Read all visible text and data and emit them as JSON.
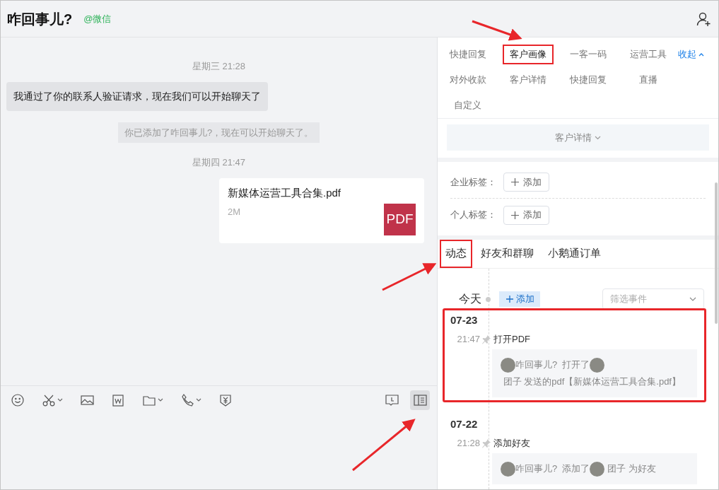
{
  "header": {
    "title": "咋回事儿?",
    "source": "@微信"
  },
  "chat": {
    "messages": [
      {
        "kind": "time",
        "text": "星期三 21:28"
      },
      {
        "kind": "bubble",
        "text": "我通过了你的联系人验证请求，现在我们可以开始聊天了"
      },
      {
        "kind": "notice",
        "text": "你已添加了咋回事儿?，现在可以开始聊天了。"
      },
      {
        "kind": "time",
        "text": "星期四 21:47"
      },
      {
        "kind": "file",
        "name": "新媒体运营工具合集.pdf",
        "size": "2M",
        "badge": "PDF"
      }
    ]
  },
  "toolbar": [
    {
      "kind": "emoji",
      "dropdown": false,
      "selected": false
    },
    {
      "kind": "scissors",
      "dropdown": true,
      "selected": false
    },
    {
      "kind": "image",
      "dropdown": false,
      "selected": false
    },
    {
      "kind": "word",
      "dropdown": false,
      "selected": false
    },
    {
      "kind": "folder",
      "dropdown": true,
      "selected": false
    },
    {
      "kind": "phone",
      "dropdown": true,
      "selected": false
    },
    {
      "kind": "yen",
      "dropdown": false,
      "selected": false
    },
    {
      "kind": "spacer"
    },
    {
      "kind": "message",
      "dropdown": false,
      "selected": false
    },
    {
      "kind": "sidebar",
      "dropdown": false,
      "selected": true
    }
  ],
  "tools": {
    "items": [
      {
        "label": "快捷回复",
        "selected": false,
        "highlighted": false
      },
      {
        "label": "客户画像",
        "selected": true,
        "highlighted": true
      },
      {
        "label": "一客一码",
        "selected": false,
        "highlighted": false
      },
      {
        "label": "运营工具",
        "selected": false,
        "highlighted": false
      },
      {
        "label": "对外收款",
        "selected": false,
        "highlighted": false
      },
      {
        "label": "客户详情",
        "selected": false,
        "highlighted": false
      },
      {
        "label": "快捷回复",
        "selected": false,
        "highlighted": false
      },
      {
        "label": "直播",
        "selected": false,
        "highlighted": false
      },
      {
        "label": "自定义",
        "selected": false,
        "highlighted": false
      }
    ],
    "collapse": "收起"
  },
  "details_toggle": "客户详情",
  "tags": [
    {
      "label": "企业标签：",
      "button": "添加"
    },
    {
      "label": "个人标签：",
      "button": "添加"
    }
  ],
  "tabs": [
    {
      "label": "动态",
      "selected": true,
      "highlighted": true
    },
    {
      "label": "好友和群聊",
      "selected": false,
      "highlighted": false
    },
    {
      "label": "小鹅通订单",
      "selected": false,
      "highlighted": false
    }
  ],
  "timeline": {
    "today": "今天",
    "add": "添加",
    "filter_placeholder": "筛选事件",
    "days": [
      {
        "date": "07-23",
        "highlighted": true,
        "events": [
          {
            "time": "21:47",
            "title": "打开PDF",
            "detail": [
              {
                "kind": "avatar"
              },
              {
                "kind": "text",
                "text": "咋回事儿?  打开了"
              },
              {
                "kind": "avatar"
              },
              {
                "kind": "text",
                "text": " 团子 发送的pdf【新媒体运营工具合集.pdf】"
              }
            ]
          }
        ]
      },
      {
        "date": "07-22",
        "highlighted": false,
        "events": [
          {
            "time": "21:28",
            "title": "添加好友",
            "detail": [
              {
                "kind": "avatar"
              },
              {
                "kind": "text",
                "text": "咋回事儿?  添加了"
              },
              {
                "kind": "avatar"
              },
              {
                "kind": "text",
                "text": " 团子 为好友"
              }
            ]
          }
        ]
      }
    ]
  }
}
